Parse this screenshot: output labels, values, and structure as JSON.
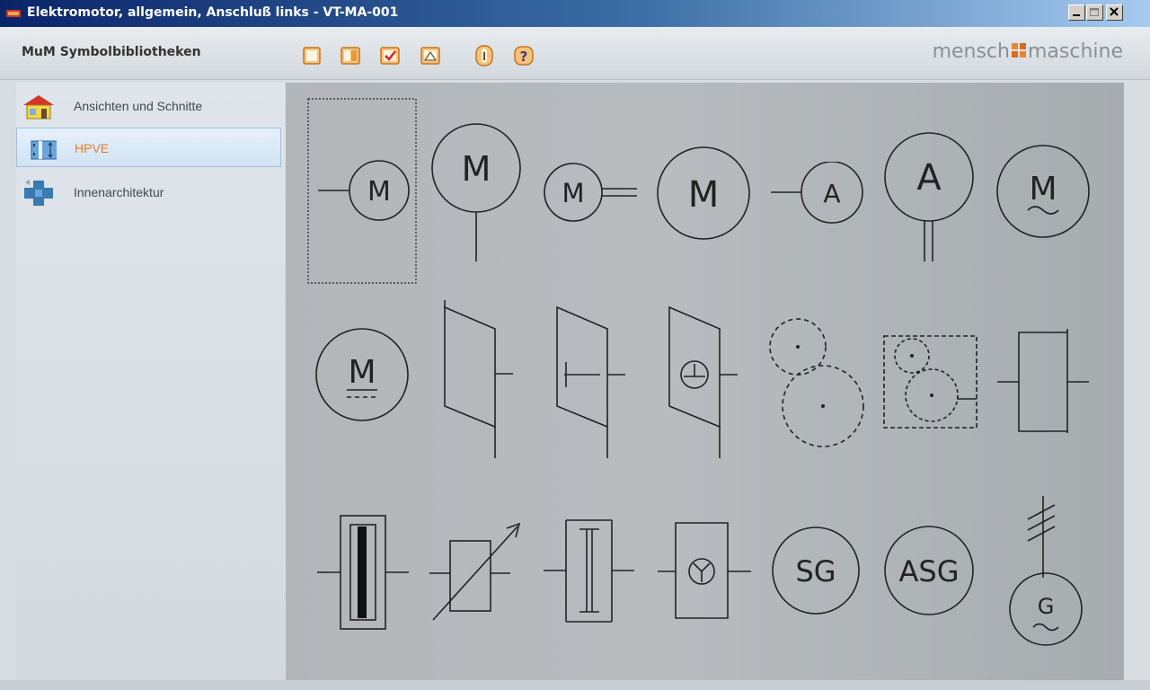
{
  "window": {
    "title": "Elektromotor, allgemein, Anschluß links - VT-MA-001"
  },
  "toolbar": {
    "library_title": "MuM Symbolbibliotheken",
    "brand_left": "mensch",
    "brand_right": "maschine",
    "buttons": [
      "blank-page-icon",
      "split-page-icon",
      "checkmark-icon",
      "chart-icon",
      "info-icon",
      "help-icon"
    ]
  },
  "sidebar": {
    "items": [
      {
        "label": "Ansichten und Schnitte",
        "icon": "house-icon"
      },
      {
        "label": "HPVE",
        "icon": "pipes-icon",
        "selected": true
      },
      {
        "label": "Innenarchitektur",
        "icon": "puzzle-icon"
      }
    ]
  },
  "symbols": {
    "row1": [
      "M",
      "M",
      "M",
      "M",
      "A",
      "A",
      "M"
    ],
    "row2": [
      "M",
      "",
      "",
      "",
      "",
      "",
      ""
    ],
    "row3": [
      "",
      "",
      "",
      "",
      "SG",
      "ASG",
      "G"
    ]
  },
  "colors": {
    "title_bar": "#0a246a",
    "selected_label": "#ea7a2a",
    "canvas": "#b5b9bc",
    "brand_accent": "#e8862e"
  }
}
